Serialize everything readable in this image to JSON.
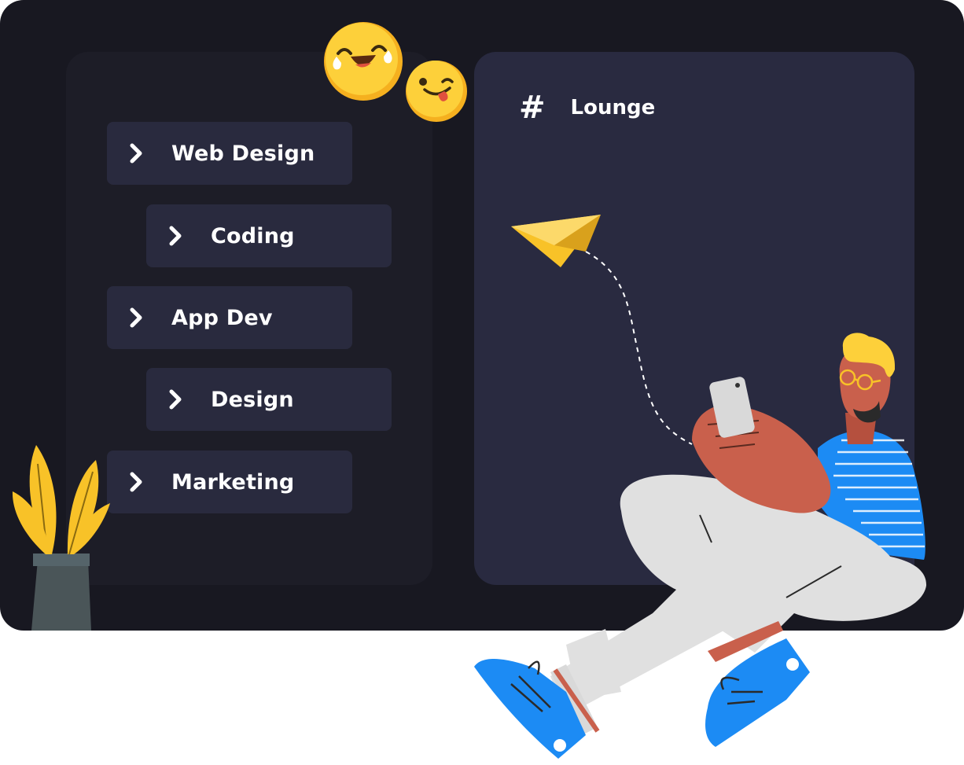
{
  "sidebar": {
    "items": [
      {
        "label": "Web Design"
      },
      {
        "label": "Coding"
      },
      {
        "label": "App Dev"
      },
      {
        "label": "Design"
      },
      {
        "label": "Marketing"
      }
    ]
  },
  "channel": {
    "symbol": "#",
    "name": "Lounge"
  },
  "colors": {
    "frame": "#181821",
    "left_panel": "#1d1d27",
    "right_panel": "#292a40",
    "chip": "#292a3e",
    "accent_yellow": "#f8c228",
    "shoe_blue": "#1c8bf4",
    "skin": "#c9604c"
  },
  "icons": [
    "chevron-right-icon",
    "hash-icon",
    "paper-plane-icon",
    "laughing-emoji-icon",
    "tongue-emoji-icon",
    "plant-illustration",
    "person-with-phone-illustration"
  ]
}
